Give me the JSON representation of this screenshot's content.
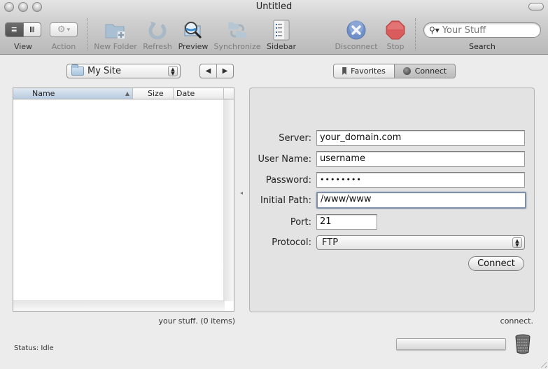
{
  "window": {
    "title": "Untitled"
  },
  "toolbar": {
    "view_label": "View",
    "action_label": "Action",
    "new_folder_label": "New Folder",
    "refresh_label": "Refresh",
    "preview_label": "Preview",
    "synchronize_label": "Synchronize",
    "sidebar_label": "Sidebar",
    "disconnect_label": "Disconnect",
    "stop_label": "Stop",
    "search_label": "Search",
    "search_placeholder": "Your Stuff",
    "view_list_icon": "≣",
    "view_columns_icon": "Ⅲ",
    "action_icon": "⚙",
    "action_caret": "▾"
  },
  "browser": {
    "site_select": "My Site",
    "back_icon": "◀",
    "forward_icon": "▶",
    "columns": [
      "Name",
      "Size",
      "Date"
    ],
    "sort_indicator": "▲",
    "rows": [],
    "items_status": "your stuff. (0 items)"
  },
  "status": {
    "text": "Status: Idle",
    "connect_text": "connect.",
    "progress": 0
  },
  "connect_panel": {
    "tabs": [
      {
        "label": "Favorites",
        "selected": false
      },
      {
        "label": "Connect",
        "selected": true
      }
    ],
    "fields": {
      "server_label": "Server:",
      "server_value": "your_domain.com",
      "username_label": "User Name:",
      "username_value": "username",
      "password_label": "Password:",
      "password_value": "••••••••",
      "initial_path_label": "Initial Path:",
      "initial_path_value": "/www/www",
      "port_label": "Port:",
      "port_value": "21",
      "protocol_label": "Protocol:",
      "protocol_value": "FTP"
    },
    "connect_button": "Connect"
  }
}
